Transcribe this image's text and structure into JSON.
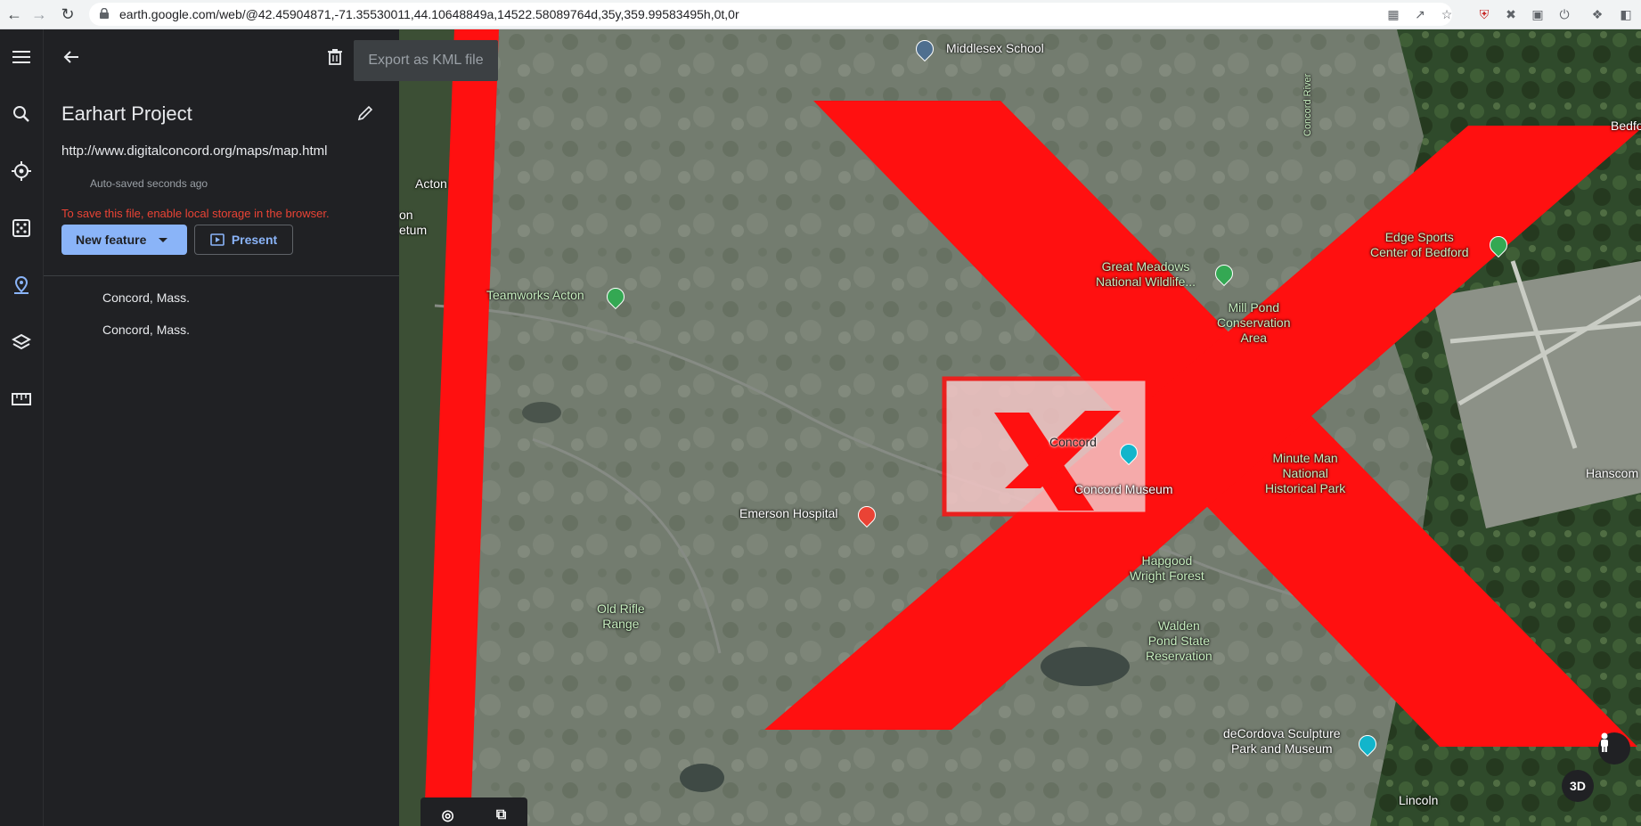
{
  "browser": {
    "url": "earth.google.com/web/@42.45904871,-71.35530011,44.10648849a,14522.58089764d,35y,359.99583495h,0t,0r"
  },
  "project": {
    "title": "Earhart Project",
    "link": "http://www.digitalconcord.org/maps/map.html",
    "autosave": "Auto-saved seconds ago",
    "warning": "To save this file, enable local storage in the browser.",
    "new_feature_label": "New feature",
    "present_label": "Present",
    "export_tooltip": "Export as KML file",
    "features": [
      "Concord, Mass.",
      "Concord, Mass."
    ]
  },
  "map": {
    "labels": {
      "middlesex": "Middlesex School",
      "acton": "Acton",
      "museum_partial": "on\netum",
      "teamworks": "Teamworks Acton",
      "great_meadows": "Great Meadows\nNational Wildlife...",
      "mill_pond": "Mill Pond\nConservation\nArea",
      "edge_sports": "Edge Sports\nCenter of Bedford",
      "bedford": "Bedfo",
      "concord_river": "Concord River",
      "concord": "Concord",
      "concord_museum": "Concord Museum",
      "emerson": "Emerson Hospital",
      "minute_man": "Minute Man\nNational\nHistorical Park",
      "hanscom": "Hanscom",
      "hapgood": "Hapgood\nWright Forest",
      "old_rifle": "Old Rifle\nRange",
      "walden": "Walden\nPond State\nReservation",
      "decordova": "deCordova Sculpture\nPark and Museum",
      "lincoln": "Lincoln"
    },
    "view_mode": "3D"
  },
  "colors": {
    "overlay_red": "#ff1010",
    "accent_blue": "#8ab4f8",
    "warning_red": "#ea4335",
    "panel_bg": "#202124"
  }
}
